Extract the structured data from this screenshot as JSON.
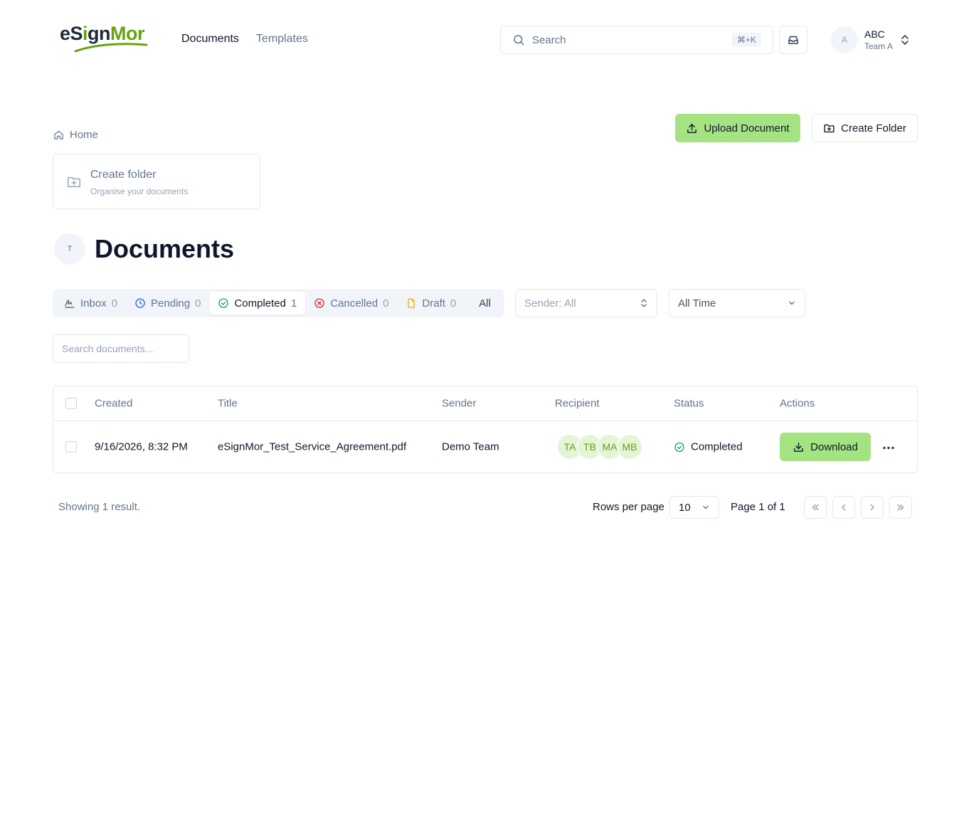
{
  "header": {
    "logo": {
      "part1": "eS",
      "part2": "i",
      "part3": "gn",
      "part4": "Mor"
    },
    "nav": [
      {
        "label": "Documents",
        "active": true
      },
      {
        "label": "Templates",
        "active": false
      }
    ],
    "search": {
      "label": "Search",
      "shortcut": "⌘+K"
    },
    "user": {
      "avatar": "A",
      "name": "ABC",
      "team": "Team A"
    }
  },
  "breadcrumb": {
    "home": "Home"
  },
  "actions": {
    "upload": "Upload Document",
    "create_folder": "Create Folder"
  },
  "folder_card": {
    "title": "Create folder",
    "subtitle": "Organise your documents"
  },
  "documents": {
    "team_avatar": "T",
    "title": "Documents"
  },
  "tabs": [
    {
      "label": "Inbox",
      "count": "0",
      "icon": "signature-icon"
    },
    {
      "label": "Pending",
      "count": "0",
      "icon": "clock-icon"
    },
    {
      "label": "Completed",
      "count": "1",
      "icon": "check-circle-icon",
      "active": true
    },
    {
      "label": "Cancelled",
      "count": "0",
      "icon": "x-circle-icon"
    },
    {
      "label": "Draft",
      "count": "0",
      "icon": "file-icon"
    },
    {
      "label": "All"
    }
  ],
  "filters": {
    "sender": "Sender: All",
    "period": "All Time"
  },
  "doc_search": {
    "placeholder": "Search documents..."
  },
  "table": {
    "columns": [
      "Created",
      "Title",
      "Sender",
      "Recipient",
      "Status",
      "Actions"
    ],
    "rows": [
      {
        "created": "9/16/2026, 8:32 PM",
        "title": "eSignMor_Test_Service_Agreement.pdf",
        "sender": "Demo Team",
        "recipients": [
          "TA",
          "TB",
          "MA",
          "MB"
        ],
        "status": "Completed",
        "action": "Download"
      }
    ]
  },
  "pagination": {
    "showing": "Showing 1 result.",
    "rows_per_page_label": "Rows per page",
    "rows_per_page": "10",
    "page": "Page 1 of 1"
  },
  "colors": {
    "accent": "#a3e381",
    "brand_green": "#65a30d",
    "success": "#16a34a",
    "danger": "#dc2626",
    "warning": "#eab308",
    "info": "#2563eb"
  }
}
